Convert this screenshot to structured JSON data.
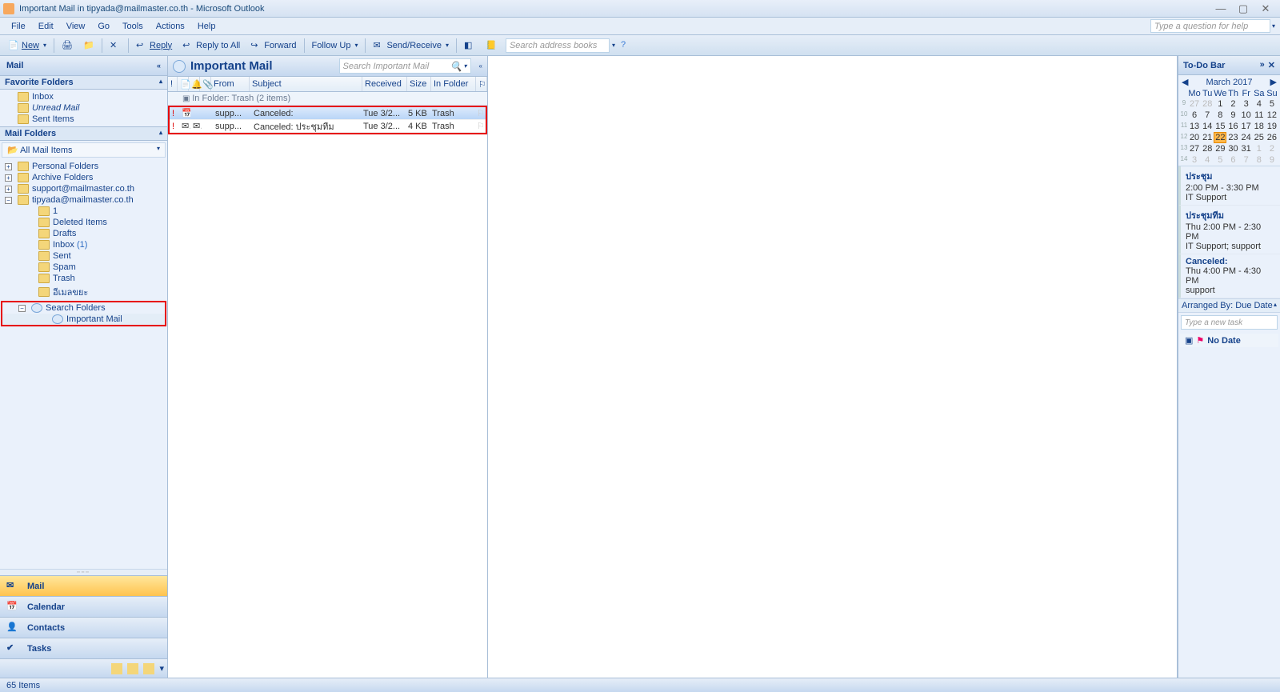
{
  "window": {
    "title": "Important Mail in tipyada@mailmaster.co.th - Microsoft Outlook"
  },
  "winbtns": {
    "min": "—",
    "max": "▢",
    "close": "✕"
  },
  "menu": {
    "file": "File",
    "edit": "Edit",
    "view": "View",
    "go": "Go",
    "tools": "Tools",
    "actions": "Actions",
    "help": "Help",
    "helpbox_placeholder": "Type a question for help"
  },
  "toolbar": {
    "new": "New",
    "print": "",
    "reply": "Reply",
    "replyall": "Reply to All",
    "forward": "Forward",
    "followup": "Follow Up",
    "sendreceive": "Send/Receive",
    "search_placeholder": "Search address books"
  },
  "nav": {
    "header": "Mail",
    "favorite_hdr": "Favorite Folders",
    "favorites": {
      "inbox": "Inbox",
      "unread": "Unread Mail",
      "sent": "Sent Items"
    },
    "mailfolders_hdr": "Mail Folders",
    "allmail": "All Mail Items",
    "tree": {
      "personal": "Personal Folders",
      "archive": "Archive Folders",
      "acct1": "support@mailmaster.co.th",
      "acct2": "tipyada@mailmaster.co.th",
      "one": "1",
      "deleted": "Deleted Items",
      "drafts": "Drafts",
      "inbox": "Inbox",
      "inbox_count": "(1)",
      "sent": "Sent",
      "spam": "Spam",
      "trash": "Trash",
      "thai": "อีเมลขยะ",
      "searchfolders": "Search Folders",
      "important": "Important Mail"
    },
    "buttons": {
      "mail": "Mail",
      "calendar": "Calendar",
      "contacts": "Contacts",
      "tasks": "Tasks"
    }
  },
  "list": {
    "title": "Important Mail",
    "search_placeholder": "Search Important Mail",
    "cols": {
      "from": "From",
      "subject": "Subject",
      "received": "Received",
      "size": "Size",
      "infolder": "In Folder"
    },
    "group": "In Folder: Trash (2 items)",
    "rows": [
      {
        "from": "supp...",
        "subject": "Canceled:",
        "received": "Tue 3/2...",
        "size": "5 KB",
        "folder": "Trash"
      },
      {
        "from": "supp...",
        "subject": "Canceled: ประชุมทีม",
        "received": "Tue 3/2...",
        "size": "4 KB",
        "folder": "Trash"
      }
    ]
  },
  "todo": {
    "header": "To-Do Bar",
    "month": "March 2017",
    "dow": [
      "Mo",
      "Tu",
      "We",
      "Th",
      "Fr",
      "Sa",
      "Su"
    ],
    "weeks": [
      {
        "wk": "9",
        "days": [
          "27",
          "28",
          "1",
          "2",
          "3",
          "4",
          "5"
        ],
        "dim": [
          0,
          1
        ]
      },
      {
        "wk": "10",
        "days": [
          "6",
          "7",
          "8",
          "9",
          "10",
          "11",
          "12"
        ],
        "dim": []
      },
      {
        "wk": "11",
        "days": [
          "13",
          "14",
          "15",
          "16",
          "17",
          "18",
          "19"
        ],
        "dim": []
      },
      {
        "wk": "12",
        "days": [
          "20",
          "21",
          "22",
          "23",
          "24",
          "25",
          "26"
        ],
        "dim": [],
        "today": 2
      },
      {
        "wk": "13",
        "days": [
          "27",
          "28",
          "29",
          "30",
          "31",
          "1",
          "2"
        ],
        "dim": [
          5,
          6
        ]
      },
      {
        "wk": "14",
        "days": [
          "3",
          "4",
          "5",
          "6",
          "7",
          "8",
          "9"
        ],
        "dim": [
          0,
          1,
          2,
          3,
          4,
          5,
          6
        ]
      }
    ],
    "appts": [
      {
        "title": "ประชุม",
        "time": "2:00 PM - 3:30 PM",
        "who": "IT Support"
      },
      {
        "title": "ประชุมทีม",
        "time": "Thu 2:00 PM - 2:30 PM",
        "who": "IT Support; support"
      },
      {
        "title": "Canceled:",
        "time": "Thu 4:00 PM - 4:30 PM",
        "who": "support"
      }
    ],
    "arrange": "Arranged By: Due Date",
    "newtask_placeholder": "Type a new task",
    "nodate": "No Date"
  },
  "status": {
    "items": "65 Items"
  }
}
